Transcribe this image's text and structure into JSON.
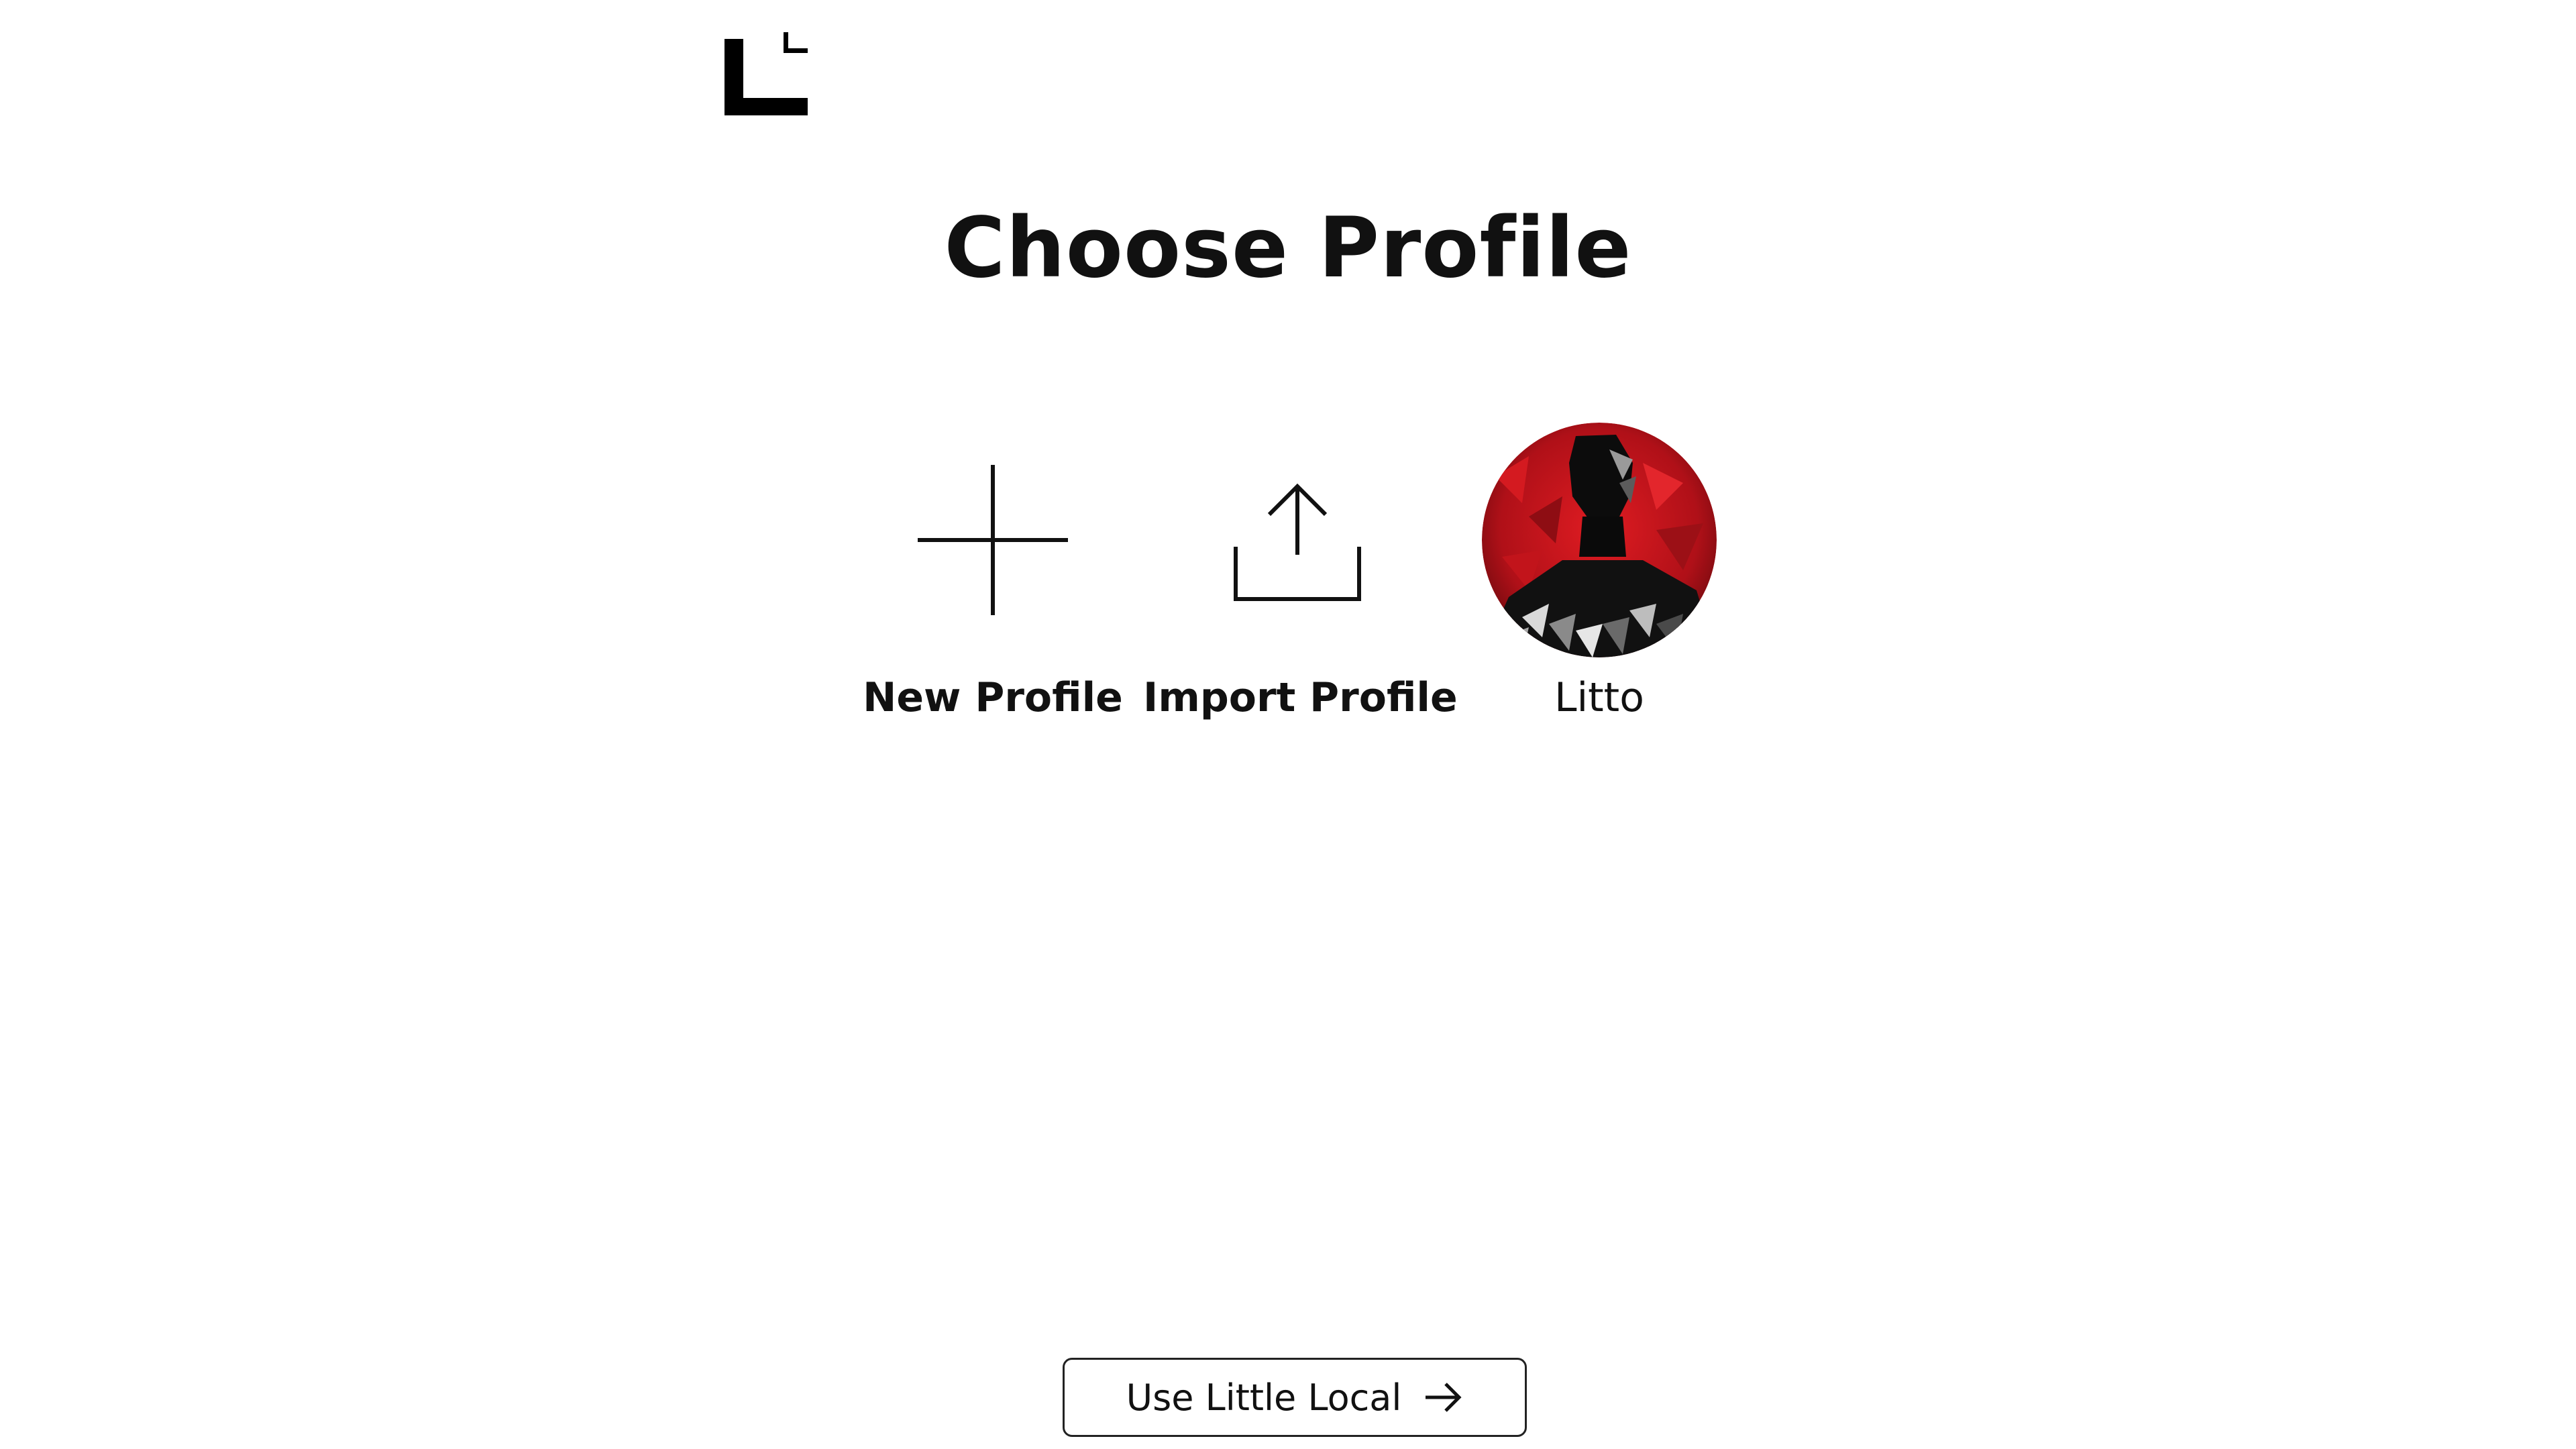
{
  "header": {
    "logo_icon": "little-logo-icon"
  },
  "title": "Choose Profile",
  "profiles": [
    {
      "label": "New Profile",
      "icon": "plus-icon"
    },
    {
      "label": "Import Profile",
      "icon": "upload-icon"
    },
    {
      "label": "Litto",
      "icon": "avatar"
    }
  ],
  "footer": {
    "local_button_label": "Use Little Local",
    "local_button_icon": "arrow-right-icon"
  },
  "colors": {
    "text": "#111111",
    "background": "#ffffff",
    "avatar_red": "#c8141c"
  }
}
